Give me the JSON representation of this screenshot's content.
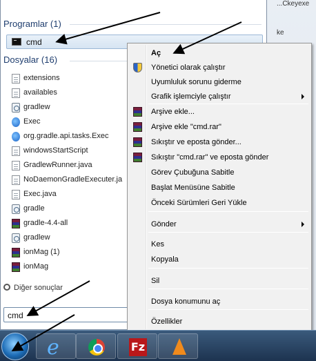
{
  "background_window": {
    "fragment_top": "...Ckeyexe",
    "fragment_mid": "ke"
  },
  "start_menu": {
    "programs_header": "Programlar (1)",
    "program_item": {
      "label": "cmd",
      "icon": "cmd-icon"
    },
    "files_header": "Dosyalar (16)",
    "files": [
      {
        "label": "extensions",
        "icon": "doc-gear-icon"
      },
      {
        "label": "availables",
        "icon": "doc-gear-icon"
      },
      {
        "label": "gradlew",
        "icon": "gear-icon"
      },
      {
        "label": "Exec",
        "icon": "ie-icon"
      },
      {
        "label": "org.gradle.api.tasks.Exec",
        "icon": "ie-icon"
      },
      {
        "label": "windowsStartScript",
        "icon": "doc-icon"
      },
      {
        "label": "GradlewRunner.java",
        "icon": "doc-icon"
      },
      {
        "label": "NoDaemonGradleExecuter.ja",
        "icon": "doc-icon"
      },
      {
        "label": "Exec.java",
        "icon": "doc-icon"
      },
      {
        "label": "gradle",
        "icon": "gear-icon"
      },
      {
        "label": "gradle-4.4-all",
        "icon": "winrar-icon"
      },
      {
        "label": "gradlew",
        "icon": "gear-icon"
      },
      {
        "label": "ionMag (1)",
        "icon": "winrar-icon"
      },
      {
        "label": "ionMag",
        "icon": "winrar-icon"
      }
    ],
    "other_results": "Diğer sonuçlar",
    "search": {
      "value": "cmd"
    }
  },
  "context_menu": {
    "items": [
      {
        "label": "Aç",
        "bold": true
      },
      {
        "label": "Yönetici olarak çalıştır",
        "icon": "shield-icon"
      },
      {
        "label": "Uyumluluk sorunu giderme"
      },
      {
        "label": "Grafik işlemciyle çalıştır",
        "submenu": true
      },
      {
        "label": "Arşive ekle...",
        "icon": "winrar-icon"
      },
      {
        "label": "Arşive ekle \"cmd.rar\"",
        "icon": "winrar-icon"
      },
      {
        "label": "Sıkıştır ve eposta gönder...",
        "icon": "winrar-icon"
      },
      {
        "label": "Sıkıştır \"cmd.rar\" ve eposta gönder",
        "icon": "winrar-icon"
      },
      {
        "label": "Görev Çubuğuna Sabitle"
      },
      {
        "label": "Başlat Menüsüne Sabitle"
      },
      {
        "label": "Önceki Sürümleri Geri Yükle"
      },
      {
        "label": "Gönder",
        "submenu": true
      },
      {
        "label": "Kes"
      },
      {
        "label": "Kopyala"
      },
      {
        "label": "Sil"
      },
      {
        "label": "Dosya konumunu aç"
      },
      {
        "label": "Özellikler"
      }
    ]
  },
  "taskbar": {
    "filezilla_letter": "Fz",
    "apps": [
      "start-orb-icon",
      "internet-explorer-icon",
      "chrome-icon",
      "filezilla-icon",
      "vlc-icon"
    ]
  },
  "colors": {
    "accent": "#1e3d6e",
    "highlight": "#d6e4f2",
    "menu_bg": "#f1f1f1",
    "taskbar": "#1d3350"
  }
}
